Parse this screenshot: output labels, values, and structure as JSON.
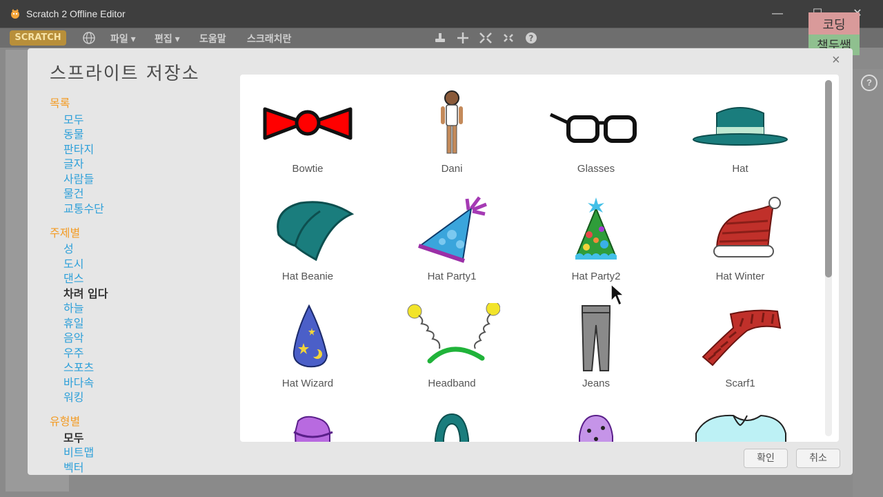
{
  "window": {
    "title": "Scratch 2 Offline Editor",
    "minimize": "—",
    "maximize": "☐",
    "close": "✕"
  },
  "menubar": {
    "logo": "SCRATCH",
    "items": [
      {
        "label": "파일 ▾"
      },
      {
        "label": "편집 ▾"
      },
      {
        "label": "도움말"
      },
      {
        "label": "스크래치란"
      }
    ]
  },
  "badge": {
    "line1": "코딩",
    "line2": "책두쌤"
  },
  "dialog": {
    "title": "스프라이트 저장소",
    "close": "×",
    "categories": {
      "heading": "목록",
      "items": [
        "모두",
        "동물",
        "판타지",
        "글자",
        "사람들",
        "물건",
        "교통수단"
      ]
    },
    "themes": {
      "heading": "주제별",
      "items": [
        "성",
        "도시",
        "댄스",
        "차려 입다",
        "하늘",
        "휴일",
        "음악",
        "우주",
        "스포츠",
        "바다속",
        "워킹"
      ],
      "selected": "차려 입다"
    },
    "types": {
      "heading": "유형별",
      "items": [
        "모두",
        "비트맵",
        "벡터"
      ],
      "selected": "모두"
    },
    "sprites": [
      {
        "name": "Bowtie"
      },
      {
        "name": "Dani"
      },
      {
        "name": "Glasses"
      },
      {
        "name": "Hat"
      },
      {
        "name": "Hat Beanie"
      },
      {
        "name": "Hat Party1"
      },
      {
        "name": "Hat Party2"
      },
      {
        "name": "Hat Winter"
      },
      {
        "name": "Hat Wizard"
      },
      {
        "name": "Headband"
      },
      {
        "name": "Jeans"
      },
      {
        "name": "Scarf1"
      }
    ],
    "ok_label": "확인",
    "cancel_label": "취소"
  },
  "help": "?",
  "colors": {
    "category_heading": "#f39c26",
    "category_link": "#2ea0d9",
    "dialog_bg": "#e6e6e6"
  }
}
